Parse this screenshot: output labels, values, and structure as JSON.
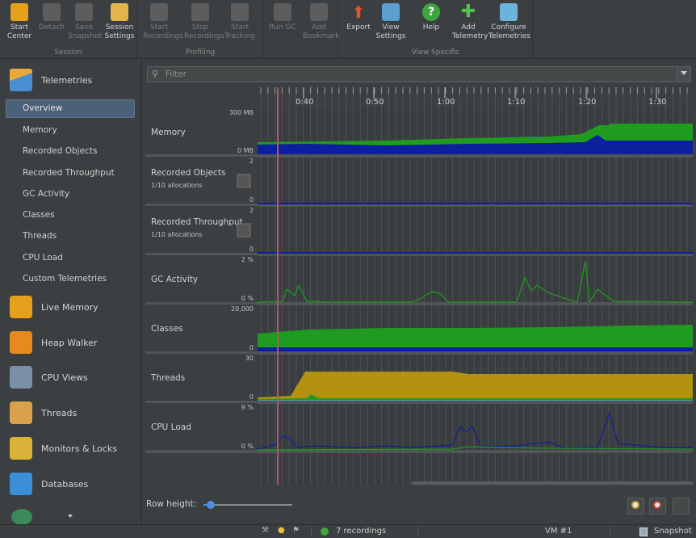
{
  "toolbar": {
    "groups": [
      {
        "title": "Session",
        "buttons": [
          {
            "label": "Start\nCenter",
            "icon": "start-center-icon",
            "enabled": true
          },
          {
            "label": "Detach",
            "icon": "detach-icon",
            "enabled": false
          },
          {
            "label": "Save\nSnapshot",
            "icon": "save-snapshot-icon",
            "enabled": false
          },
          {
            "label": "Session\nSettings",
            "icon": "session-settings-icon",
            "enabled": true
          }
        ]
      },
      {
        "title": "Profiling",
        "buttons": [
          {
            "label": "Start\nRecordings",
            "icon": "start-recordings-icon",
            "enabled": false
          },
          {
            "label": "Stop\nRecordings",
            "icon": "stop-recordings-icon",
            "enabled": false
          },
          {
            "label": "Start\nTracking",
            "icon": "start-tracking-icon",
            "enabled": false
          }
        ]
      },
      {
        "title": "",
        "buttons": [
          {
            "label": "Run GC",
            "icon": "run-gc-icon",
            "enabled": false
          },
          {
            "label": "Add\nBookmark",
            "icon": "add-bookmark-icon",
            "enabled": false
          }
        ]
      },
      {
        "title": "View Specific",
        "buttons": [
          {
            "label": "Export",
            "icon": "export-icon",
            "enabled": true
          },
          {
            "label": "View\nSettings",
            "icon": "view-settings-icon",
            "enabled": true
          },
          {
            "label": "Help",
            "icon": "help-icon",
            "enabled": true
          },
          {
            "label": "Add\nTelemetry",
            "icon": "add-telemetry-icon",
            "enabled": true
          },
          {
            "label": "Configure\nTelemetries",
            "icon": "configure-telemetries-icon",
            "enabled": true
          }
        ]
      }
    ]
  },
  "sidebar": {
    "telemetries_label": "Telemetries",
    "telemetry_items": [
      "Overview",
      "Memory",
      "Recorded Objects",
      "Recorded Throughput",
      "GC Activity",
      "Classes",
      "Threads",
      "CPU Load",
      "Custom Telemetries"
    ],
    "selected": "Overview",
    "sections": [
      "Live Memory",
      "Heap Walker",
      "CPU Views",
      "Threads",
      "Monitors & Locks",
      "Databases"
    ]
  },
  "filter": {
    "placeholder": "Filter"
  },
  "timeline": {
    "ticks": [
      "0:40",
      "0:50",
      "1:00",
      "1:10",
      "1:20",
      "1:30"
    ]
  },
  "rows": [
    {
      "name": "Memory",
      "sub": "",
      "ymax": "300 MB",
      "ymin": "0 MB"
    },
    {
      "name": "Recorded Objects",
      "sub": "1/10 allocations",
      "ymax": "2",
      "ymin": "0"
    },
    {
      "name": "Recorded Throughput",
      "sub": "1/10 allocations",
      "ymax": "2",
      "ymin": "0"
    },
    {
      "name": "GC Activity",
      "sub": "",
      "ymax": "2 %",
      "ymin": "0 %"
    },
    {
      "name": "Classes",
      "sub": "",
      "ymax": "20,000",
      "ymin": "0"
    },
    {
      "name": "Threads",
      "sub": "",
      "ymax": "30",
      "ymin": "0"
    },
    {
      "name": "CPU Load",
      "sub": "",
      "ymax": "9 %",
      "ymin": "0 %"
    }
  ],
  "colors": {
    "green": "#1f9b1f",
    "blue": "#0d1f9c",
    "gold": "#b3920f",
    "marker": "#c0506a",
    "accent": "#4b6079"
  },
  "bottom": {
    "row_height_label": "Row height:",
    "row_height_value": 0.08
  },
  "status": {
    "recordings": "7 recordings",
    "vm": "VM #1",
    "snapshot": "Snapshot"
  }
}
